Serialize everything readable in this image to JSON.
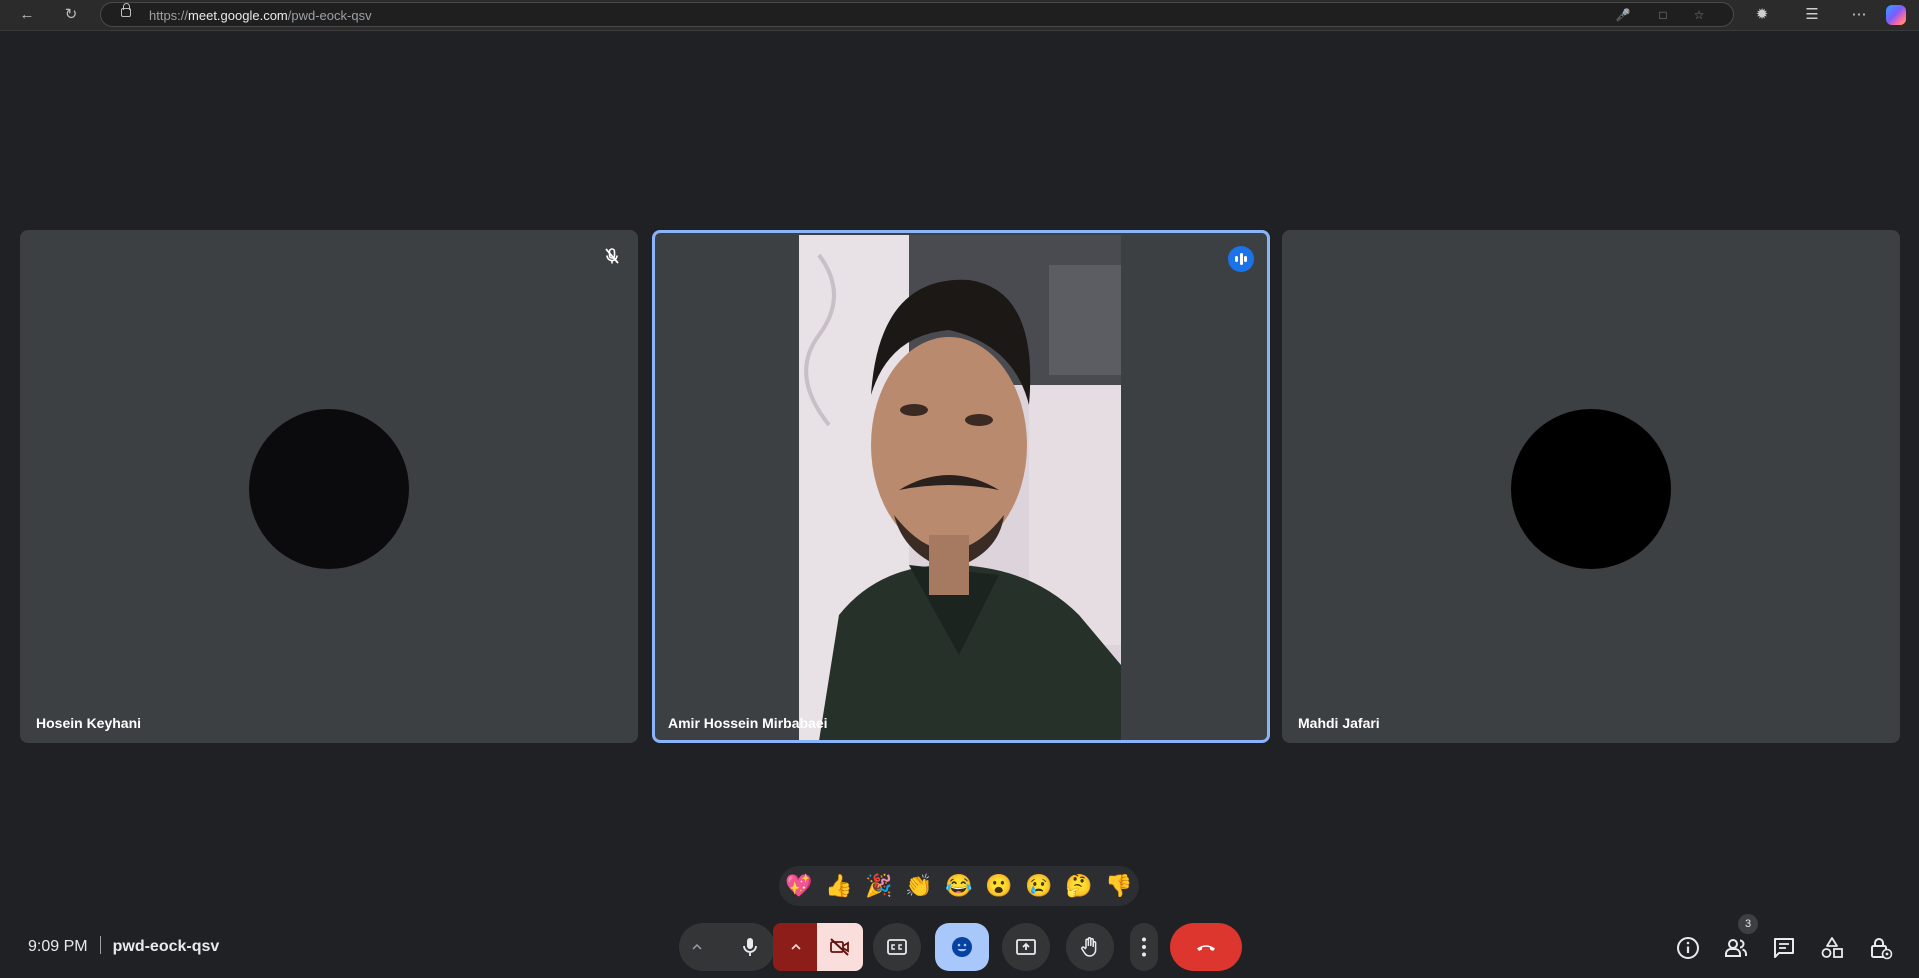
{
  "browser": {
    "url_scheme": "https://",
    "url_host": "meet.google.com",
    "url_path": "/pwd-eock-qsv"
  },
  "participants": [
    {
      "name": "Hosein Keyhani",
      "muted": true,
      "video_on": false
    },
    {
      "name": "Amir Hossein Mirbabaei",
      "muted": false,
      "speaking": true,
      "video_on": true
    },
    {
      "name": "Mahdi Jafari",
      "muted": false,
      "video_on": false
    }
  ],
  "reactions": [
    "💖",
    "👍",
    "🎉",
    "👏",
    "😂",
    "😮",
    "😢",
    "🤔",
    "👎"
  ],
  "meeting": {
    "time": "9:09 PM",
    "code": "pwd-eock-qsv"
  },
  "controls": {
    "people_count": "3"
  },
  "colors": {
    "background": "#202124",
    "tile": "#3c4043",
    "accent": "#8ab4f8",
    "speaking": "#1a73e8",
    "end_call": "#ea4335",
    "camera_off": "#f9dedc"
  }
}
